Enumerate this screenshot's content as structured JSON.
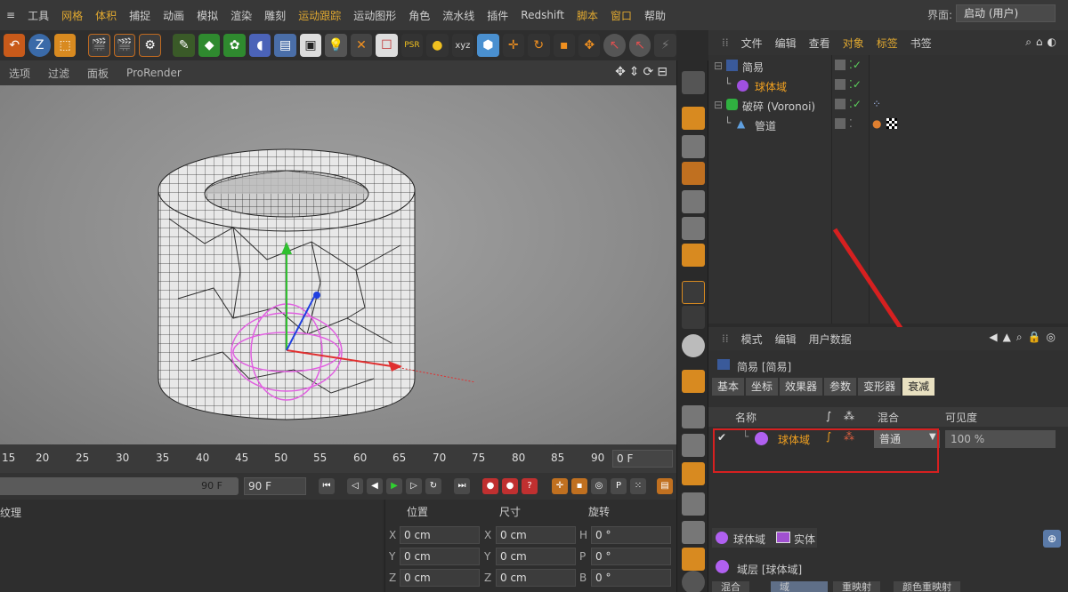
{
  "menubar": {
    "items": [
      "≡",
      "工具",
      "网格",
      "体积",
      "捕捉",
      "动画",
      "模拟",
      "渲染",
      "雕刻",
      "运动跟踪",
      "运动图形",
      "角色",
      "流水线",
      "插件",
      "Redshift",
      "脚本",
      "窗口",
      "帮助"
    ],
    "layout_label": "界面:",
    "layout_value": "启动 (用户)"
  },
  "viewport": {
    "menus": [
      "选项",
      "过滤",
      "面板",
      "ProRender"
    ]
  },
  "timeline": {
    "ticks": [
      "15",
      "20",
      "25",
      "30",
      "35",
      "40",
      "45",
      "50",
      "55",
      "60",
      "65",
      "70",
      "75",
      "80",
      "85",
      "90"
    ],
    "current_frame": "0 F",
    "range_end": "90 F",
    "end_frame": "90 F"
  },
  "material_panel": {
    "title": "纹理"
  },
  "coordinates": {
    "headers": [
      "位置",
      "尺寸",
      "旋转"
    ],
    "rows": [
      {
        "pos_axis": "X",
        "pos": "0 cm",
        "size_axis": "X",
        "size": "0 cm",
        "rot_axis": "H",
        "rot": "0 °"
      },
      {
        "pos_axis": "Y",
        "pos": "0 cm",
        "size_axis": "Y",
        "size": "0 cm",
        "rot_axis": "P",
        "rot": "0 °"
      },
      {
        "pos_axis": "Z",
        "pos": "0 cm",
        "size_axis": "Z",
        "size": "0 cm",
        "rot_axis": "B",
        "rot": "0 °"
      }
    ]
  },
  "object_manager": {
    "menus": [
      "文件",
      "编辑",
      "查看",
      "对象",
      "标签",
      "书签"
    ],
    "objects": [
      {
        "name": "简易",
        "highlight": false
      },
      {
        "name": "球体域",
        "highlight": true
      },
      {
        "name": "破碎 (Voronoi)",
        "highlight": false
      },
      {
        "name": "管道",
        "highlight": false
      }
    ]
  },
  "attribute_manager": {
    "menus": [
      "模式",
      "编辑",
      "用户数据"
    ],
    "title": "简易 [简易]",
    "tabs": [
      "基本",
      "坐标",
      "效果器",
      "参数",
      "变形器",
      "衰减"
    ],
    "active_tab": "衰减",
    "falloff_headers": [
      "名称",
      "混合",
      "可见度"
    ],
    "falloff_row": {
      "name": "球体域",
      "mode": "普通",
      "visibility": "100 %"
    },
    "chip_field": "球体域",
    "chip_extra": "实体",
    "layer_label": "域层 [球体域]",
    "bottom_tabs": [
      "混合",
      "域",
      "重映射",
      "颜色重映射"
    ]
  },
  "colors": {
    "accent": "#e0a830",
    "selection": "#f0a020",
    "annotation": "#d62020"
  }
}
